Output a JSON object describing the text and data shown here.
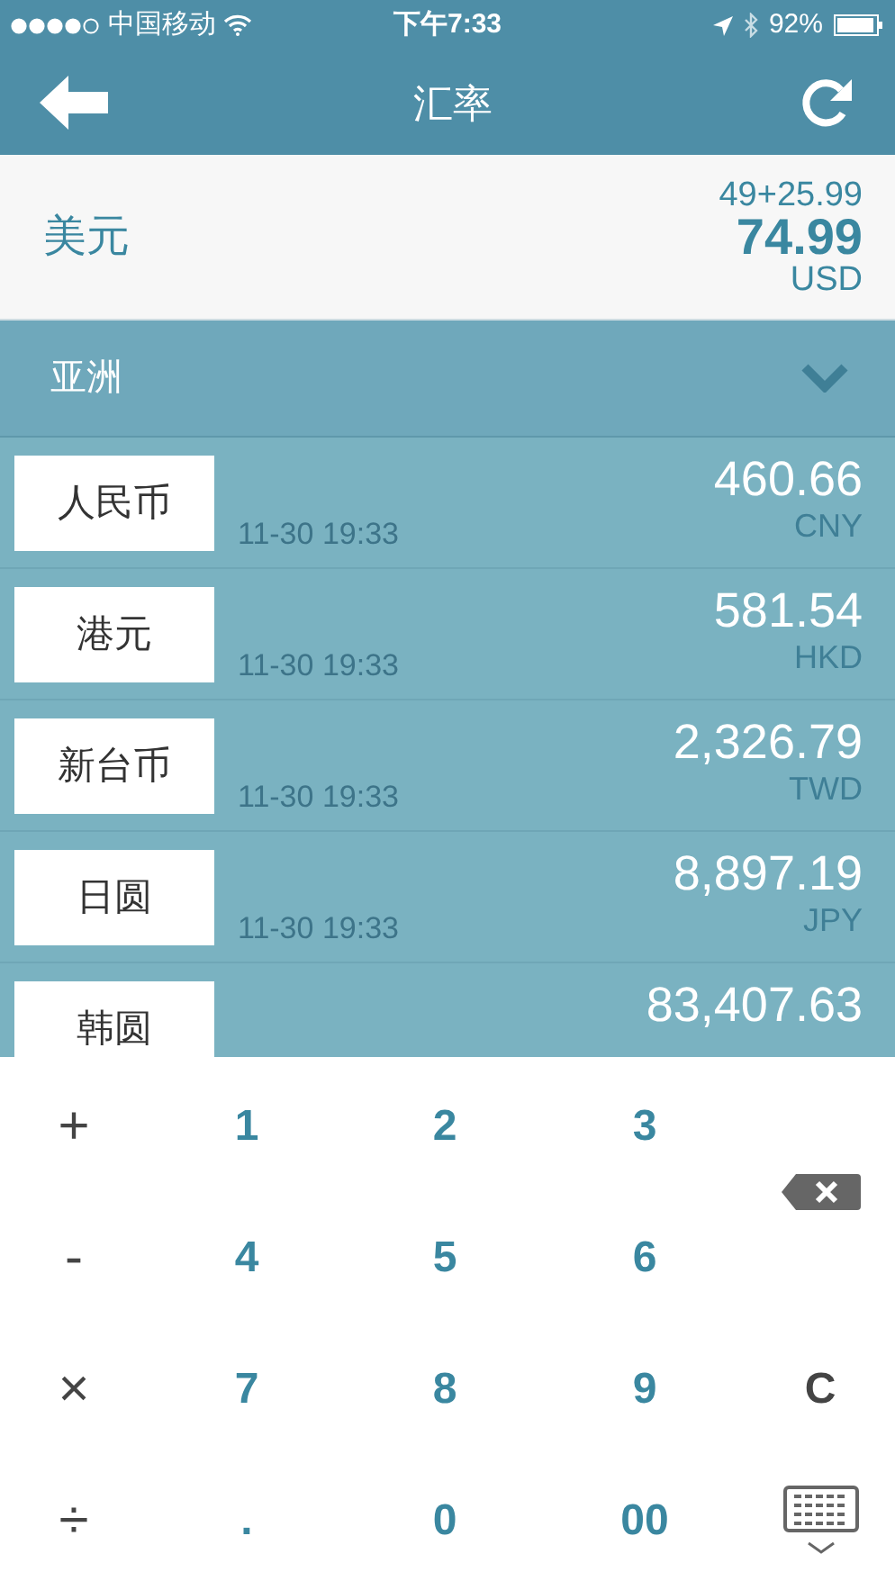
{
  "status_bar": {
    "carrier": "中国移动",
    "time": "下午7:33",
    "battery": "92%"
  },
  "nav": {
    "title": "汇率"
  },
  "base": {
    "name": "美元",
    "expression": "49+25.99",
    "amount": "74.99",
    "code": "USD"
  },
  "section": {
    "title": "亚洲",
    "expanded": true
  },
  "rates": [
    {
      "name": "人民币",
      "time": "11-30 19:33",
      "amount": "460.66",
      "code": "CNY"
    },
    {
      "name": "港元",
      "time": "11-30 19:33",
      "amount": "581.54",
      "code": "HKD"
    },
    {
      "name": "新台币",
      "time": "11-30 19:33",
      "amount": "2,326.79",
      "code": "TWD"
    },
    {
      "name": "日圆",
      "time": "11-30 19:33",
      "amount": "8,897.19",
      "code": "JPY"
    },
    {
      "name": "韩圆",
      "amount": "83,407.63"
    }
  ],
  "keypad": [
    {
      "kind": "op",
      "label": "+"
    },
    {
      "kind": "digit",
      "label": "1"
    },
    {
      "kind": "digit",
      "label": "2"
    },
    {
      "kind": "digit",
      "label": "3"
    },
    {
      "kind": "backspace"
    },
    {
      "kind": "op",
      "label": "-"
    },
    {
      "kind": "digit",
      "label": "4"
    },
    {
      "kind": "digit",
      "label": "5"
    },
    {
      "kind": "digit",
      "label": "6"
    },
    {
      "kind": "op",
      "label": "×"
    },
    {
      "kind": "digit",
      "label": "7"
    },
    {
      "kind": "digit",
      "label": "8"
    },
    {
      "kind": "digit",
      "label": "9"
    },
    {
      "kind": "clear",
      "label": "C"
    },
    {
      "kind": "op",
      "label": "÷"
    },
    {
      "kind": "digit",
      "label": "."
    },
    {
      "kind": "digit",
      "label": "0"
    },
    {
      "kind": "digit",
      "label": "00"
    },
    {
      "kind": "hide_keyboard"
    }
  ]
}
